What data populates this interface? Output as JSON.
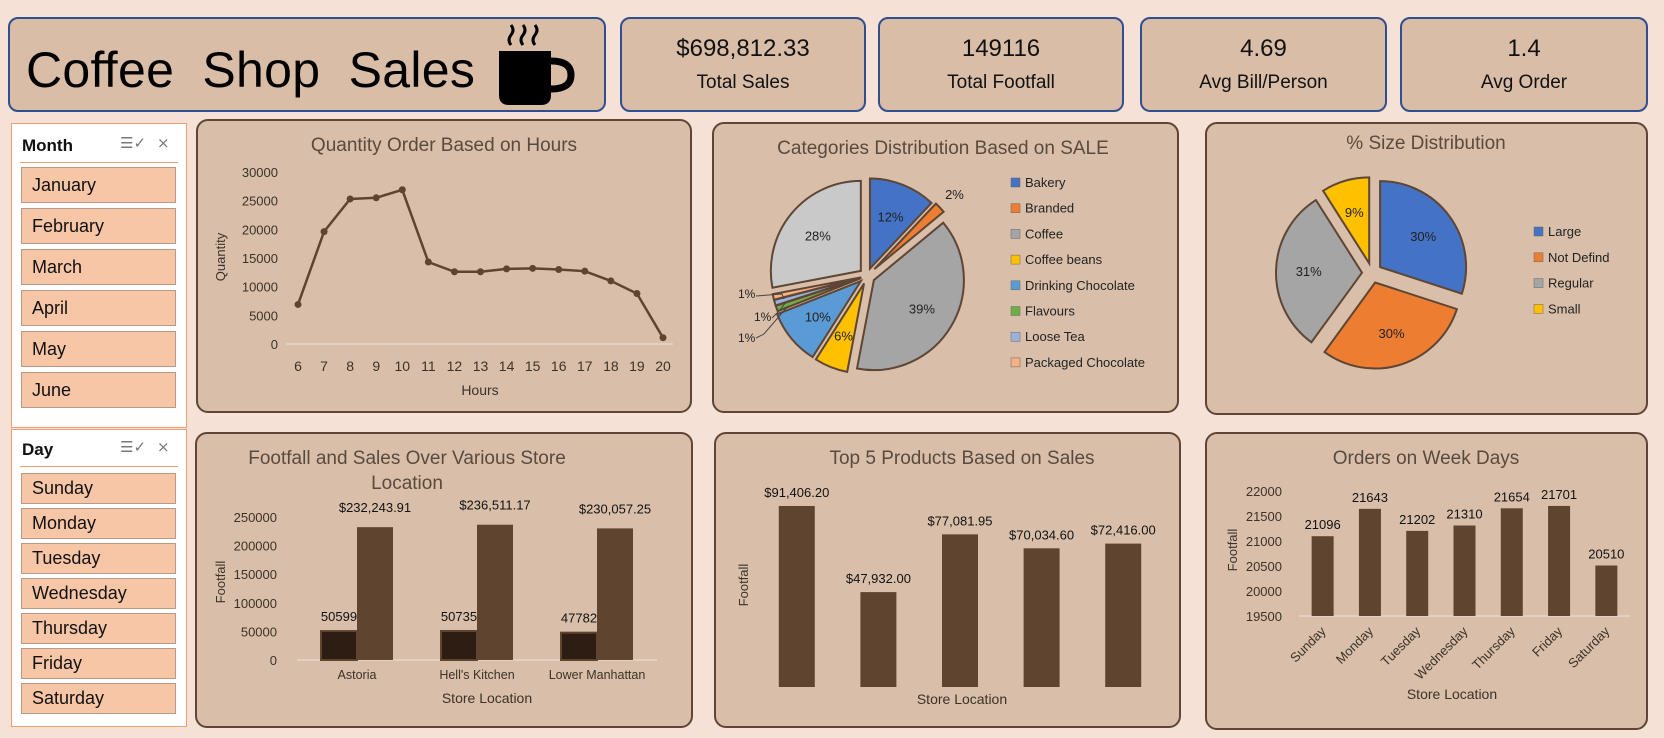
{
  "header": {
    "title": "Coffee Shop Sales",
    "kpis": [
      {
        "value": "$698,812.33",
        "label": "Total Sales"
      },
      {
        "value": "149116",
        "label": "Total Footfall"
      },
      {
        "value": "4.69",
        "label": "Avg Bill/Person"
      },
      {
        "value": "1.4",
        "label": "Avg Order"
      }
    ]
  },
  "slicers": {
    "month": {
      "title": "Month",
      "items": [
        "January",
        "February",
        "March",
        "April",
        "May",
        "June"
      ]
    },
    "day": {
      "title": "Day",
      "items": [
        "Sunday",
        "Monday",
        "Tuesday",
        "Wednesday",
        "Thursday",
        "Friday",
        "Saturday"
      ]
    }
  },
  "colors": {
    "bar": "#5f4530",
    "bar_dark": "#2e1d12",
    "line": "#5f4530",
    "panel_bg": "#d9bfa9",
    "border": "#5e4534",
    "kpi_border": "#2f4f8f"
  },
  "chart_data": [
    {
      "type": "line",
      "title": "Quantity Order Based on Hours",
      "xlabel": "Hours",
      "ylabel": "Quantity",
      "x": [
        6,
        7,
        8,
        9,
        10,
        11,
        12,
        13,
        14,
        15,
        16,
        17,
        18,
        19,
        20
      ],
      "values": [
        6900,
        19600,
        25300,
        25500,
        26900,
        14300,
        12600,
        12600,
        13100,
        13200,
        13000,
        12700,
        11000,
        8800,
        1100
      ],
      "ylim": [
        0,
        30000
      ],
      "yticks": [
        0,
        5000,
        10000,
        15000,
        20000,
        25000,
        30000
      ],
      "grid": false
    },
    {
      "type": "pie",
      "title": "Categories Distribution Based on SALE",
      "legend_position": "right",
      "slices": [
        {
          "label": "Bakery",
          "value": 12,
          "text": "12%",
          "color": "#4472c4"
        },
        {
          "label": "Branded",
          "value": 2,
          "text": "2%",
          "color": "#ed7d31"
        },
        {
          "label": "Coffee",
          "value": 39,
          "text": "39%",
          "color": "#a5a5a5"
        },
        {
          "label": "Coffee beans",
          "value": 6,
          "text": "6%",
          "color": "#ffc000"
        },
        {
          "label": "Drinking Chocolate",
          "value": 10,
          "text": "10%",
          "color": "#5b9bd5"
        },
        {
          "label": "Flavours",
          "value": 1,
          "text": "1%",
          "color": "#70ad47"
        },
        {
          "label": "Loose Tea",
          "value": 1,
          "text": "1%",
          "color": "#9ab3de"
        },
        {
          "label": "Packaged Chocolate",
          "value": 1,
          "text": "1%",
          "color": "#f4b183"
        },
        {
          "label": "",
          "value": 28,
          "text": "28%",
          "color": "#c9c9c9"
        }
      ]
    },
    {
      "type": "pie",
      "title": "%  Size Distribution",
      "legend_position": "right",
      "slices": [
        {
          "label": "Large",
          "value": 30,
          "text": "30%",
          "color": "#4472c4"
        },
        {
          "label": "Not Defind",
          "value": 30,
          "text": "30%",
          "color": "#ed7d31"
        },
        {
          "label": "Regular",
          "value": 31,
          "text": "31%",
          "color": "#a5a5a5"
        },
        {
          "label": "Small",
          "value": 9,
          "text": "9%",
          "color": "#ffc000"
        }
      ]
    },
    {
      "type": "bar",
      "title": "Footfall and Sales Over Various Store Location",
      "title_lines": [
        "Footfall and Sales Over Various Store",
        "Location"
      ],
      "xlabel": "Store Location",
      "ylabel": "Footfall",
      "categories": [
        "Astoria",
        "Hell's Kitchen",
        "Lower Manhattan"
      ],
      "series": [
        {
          "values": [
            50599,
            50735,
            47782
          ],
          "labels": [
            "50599",
            "50735",
            "47782"
          ]
        },
        {
          "values": [
            232243.91,
            236511.17,
            230057.25
          ],
          "labels": [
            "$232,243.91",
            "$236,511.17",
            "$230,057.25"
          ]
        }
      ],
      "ylim": [
        0,
        250000
      ],
      "yticks": [
        0,
        50000,
        100000,
        150000,
        200000,
        250000
      ]
    },
    {
      "type": "bar",
      "title": "Top 5 Products Based on Sales",
      "xlabel": "Store Location",
      "ylabel": "Footfall",
      "values": [
        91406.2,
        47932.0,
        77081.95,
        70034.6,
        72416.0
      ],
      "labels": [
        "$91,406.20",
        "$47,932.00",
        "$77,081.95",
        "$70,034.60",
        "$72,416.00"
      ],
      "ylim": [
        0,
        100000
      ]
    },
    {
      "type": "bar",
      "title": "Orders on Week Days",
      "xlabel": "Store Location",
      "ylabel": "Footfall",
      "categories": [
        "Sunday",
        "Monday",
        "Tuesday",
        "Wednesday",
        "Thursday",
        "Friday",
        "Saturday"
      ],
      "values": [
        21096,
        21643,
        21202,
        21310,
        21654,
        21701,
        20510
      ],
      "ylim": [
        19500,
        22000
      ],
      "yticks": [
        19500,
        20000,
        20500,
        21000,
        21500,
        22000
      ]
    }
  ]
}
